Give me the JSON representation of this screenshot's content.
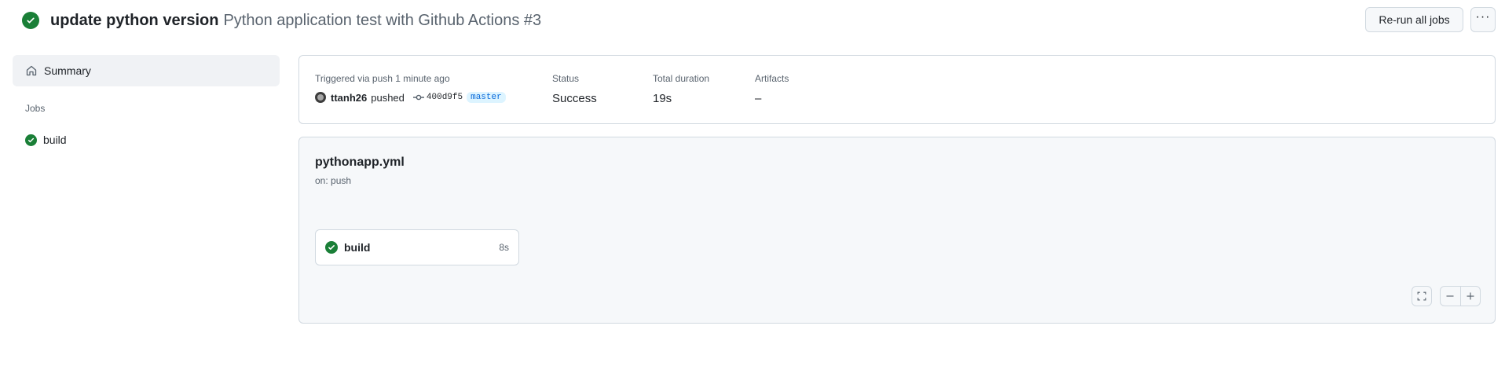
{
  "header": {
    "title": "update python version",
    "subtitle": "Python application test with Github Actions #3",
    "rerun_label": "Re-run all jobs",
    "more_label": "···"
  },
  "sidebar": {
    "summary_label": "Summary",
    "jobs_heading": "Jobs",
    "jobs": [
      {
        "label": "build",
        "status": "success"
      }
    ]
  },
  "summary": {
    "trigger_label": "Triggered via push 1 minute ago",
    "user": "ttanh26",
    "action": "pushed",
    "commit_sha": "400d9f5",
    "branch": "master",
    "status_label": "Status",
    "status_value": "Success",
    "duration_label": "Total duration",
    "duration_value": "19s",
    "artifacts_label": "Artifacts",
    "artifacts_value": "–"
  },
  "workflow": {
    "file": "pythonapp.yml",
    "trigger": "on: push",
    "jobs": [
      {
        "label": "build",
        "duration": "8s",
        "status": "success"
      }
    ]
  },
  "icons": {
    "status": "check-circle-icon",
    "summary": "home-icon",
    "commit": "git-commit-icon",
    "fullscreen": "fullscreen-icon",
    "zoom_out": "minus-icon",
    "zoom_in": "plus-icon",
    "more": "kebab-horizontal-icon"
  },
  "colors": {
    "success": "#1a7f37",
    "branch_bg": "#ddf4ff",
    "branch_fg": "#0969da",
    "border": "#d1d9e0",
    "muted": "#59636e"
  }
}
